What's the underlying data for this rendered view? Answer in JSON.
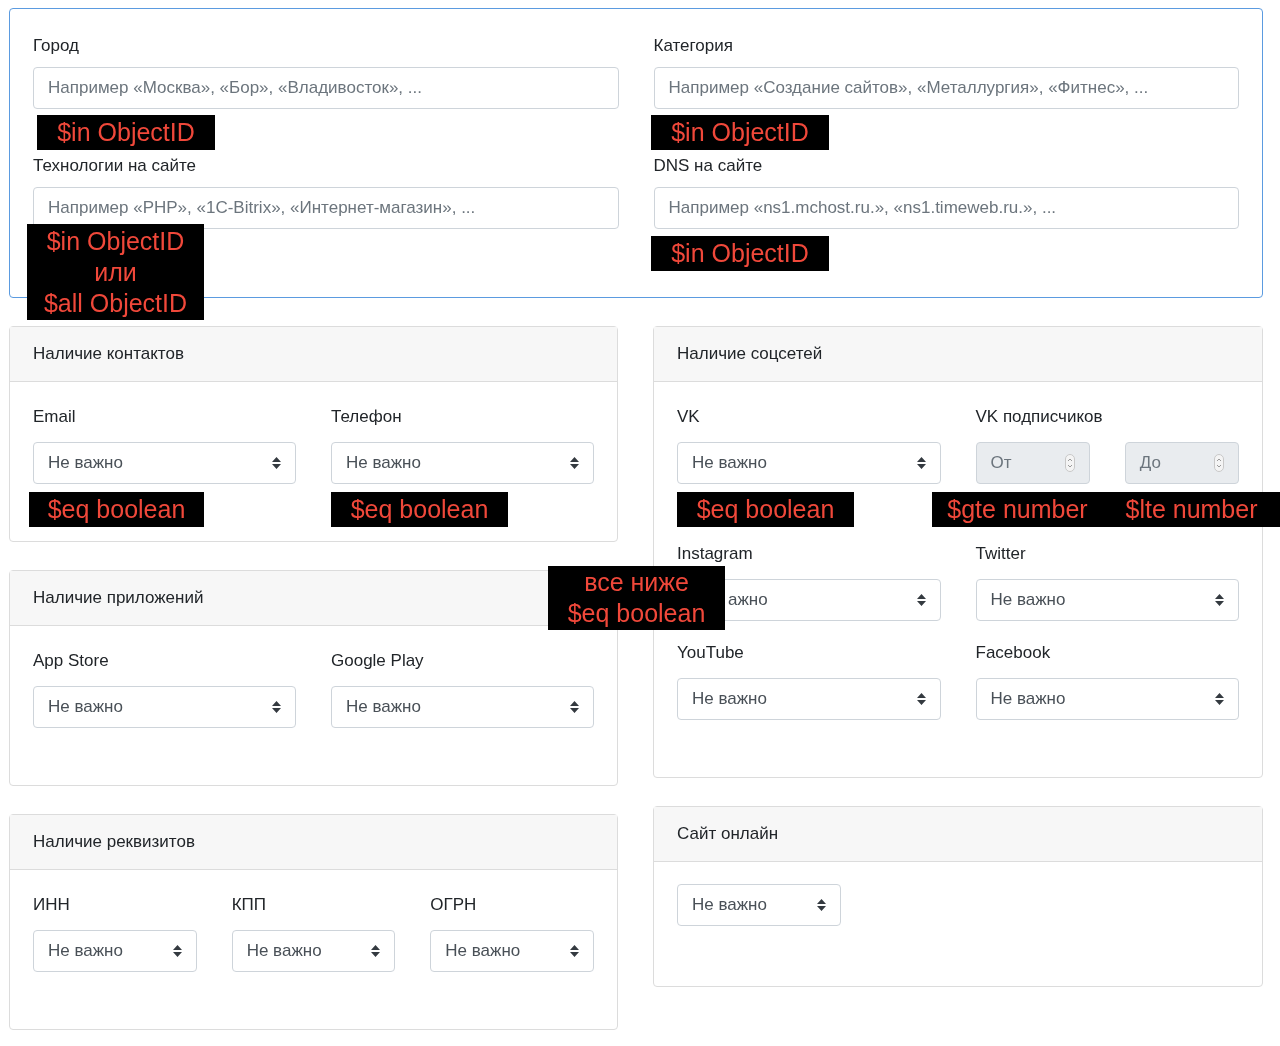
{
  "filters": {
    "fields": [
      {
        "label": "Город",
        "placeholder": "Например «Москва», «Бор», «Владивосток», ..."
      },
      {
        "label": "Категория",
        "placeholder": "Например «Создание сайтов», «Металлургия», «Фитнес», ..."
      },
      {
        "label": "Технологии на сайте",
        "placeholder": "Например «PHP», «1C-Bitrix», «Интернет-магазин», ..."
      },
      {
        "label": "DNS на сайте",
        "placeholder": "Например «ns1.mchost.ru.», «ns1.timeweb.ru.», ..."
      }
    ]
  },
  "columns": [
    [
      {
        "title": "Наличие контактов",
        "fields": [
          {
            "kind": "select",
            "label": "Email",
            "value": "Не важно"
          },
          {
            "kind": "select",
            "label": "Телефон",
            "value": "Не важно"
          }
        ]
      },
      {
        "title": "Наличие приложений",
        "fields": [
          {
            "kind": "select",
            "label": "App Store",
            "value": "Не важно"
          },
          {
            "kind": "select",
            "label": "Google Play",
            "value": "Не важно"
          }
        ]
      },
      {
        "title": "Наличие реквизитов",
        "fields": [
          {
            "kind": "select",
            "label": "ИНН",
            "value": "Не важно"
          },
          {
            "kind": "select",
            "label": "КПП",
            "value": "Не важно"
          },
          {
            "kind": "select",
            "label": "ОГРН",
            "value": "Не важно"
          }
        ]
      }
    ],
    [
      {
        "title": "Наличие соцсетей",
        "fields": [
          {
            "kind": "select",
            "label": "VK",
            "value": "Не важно"
          },
          {
            "kind": "range",
            "label": "VK подписчиков",
            "inputs": [
              {
                "placeholder": "От",
                "disabled": true
              },
              {
                "placeholder": "До",
                "disabled": true
              }
            ]
          },
          {
            "kind": "select",
            "label": "Instagram",
            "value": "ажно",
            "cut_start": true
          },
          {
            "kind": "select",
            "label": "Twitter",
            "value": "Не важно"
          },
          {
            "kind": "select",
            "label": "YouTube",
            "value": "Не важно"
          },
          {
            "kind": "select",
            "label": "Facebook",
            "value": "Не важно"
          }
        ]
      },
      {
        "title": "Сайт онлайн",
        "fields": [
          {
            "kind": "select",
            "value": "Не важно"
          }
        ]
      }
    ]
  ],
  "annotations": [
    {
      "lines": [
        "$in ObjectID"
      ]
    },
    {
      "lines": [
        "$in ObjectID"
      ]
    },
    {
      "lines": [
        "$in ObjectID",
        "или",
        "$all ObjectID"
      ]
    },
    {
      "lines": [
        "$in ObjectID"
      ]
    },
    {
      "lines": [
        "$eq boolean"
      ]
    },
    {
      "lines": [
        "$eq boolean"
      ]
    },
    {
      "lines": [
        "$eq boolean"
      ]
    },
    {
      "lines": [
        "$gte number"
      ]
    },
    {
      "lines": [
        "$lte number"
      ]
    },
    {
      "lines": [
        "все ниже",
        "$eq boolean"
      ]
    }
  ]
}
